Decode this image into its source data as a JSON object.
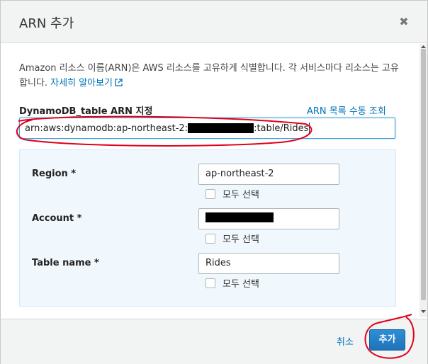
{
  "dialog": {
    "title": "ARN 추가",
    "close_symbol": "✖"
  },
  "description": {
    "text": "Amazon 리소스 이름(ARN)은 AWS 리소스를 고유하게 식별합니다. 각 서비스마다 리소스는 고유합니다.",
    "learn_more": "자세히 알아보기"
  },
  "arn": {
    "label": "DynamoDB_table ARN 지정",
    "manual_link": "ARN 목록 수동 조회",
    "value_prefix": "arn:aws:dynamodb:ap-northeast-2:",
    "value_suffix": ":table/Rides"
  },
  "fields": {
    "region": {
      "label": "Region *",
      "value": "ap-northeast-2",
      "any_label": "모두 선택"
    },
    "account": {
      "label": "Account *",
      "value": "",
      "any_label": "모두 선택"
    },
    "table": {
      "label": "Table name *",
      "value": "Rides",
      "any_label": "모두 선택"
    }
  },
  "footer": {
    "cancel": "취소",
    "add": "추가"
  },
  "colors": {
    "link": "#0073bb",
    "primary_button": "#1f73b8",
    "annotation": "#e0001b"
  },
  "icons": {
    "close": "close-icon",
    "external_link": "external-link-icon"
  }
}
